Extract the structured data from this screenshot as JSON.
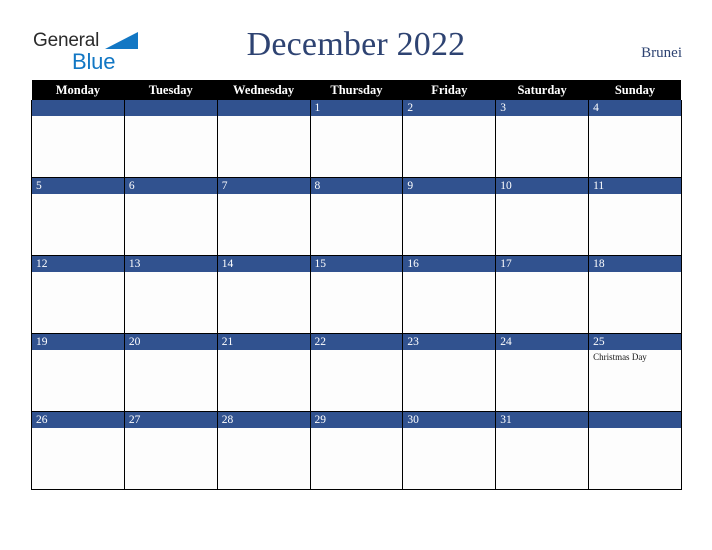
{
  "brand": {
    "name_part1": "General",
    "name_part2": "Blue",
    "triangle_icon": "triangle-icon",
    "color_dark": "#2b2b2b",
    "color_blue": "#1277c4"
  },
  "header": {
    "title": "December 2022",
    "country": "Brunei",
    "title_color": "#2e4372"
  },
  "calendar": {
    "accent_color": "#31528f",
    "header_bg": "#000000",
    "weekdays": [
      "Monday",
      "Tuesday",
      "Wednesday",
      "Thursday",
      "Friday",
      "Saturday",
      "Sunday"
    ],
    "weeks": [
      [
        {
          "date": "",
          "holiday": ""
        },
        {
          "date": "",
          "holiday": ""
        },
        {
          "date": "",
          "holiday": ""
        },
        {
          "date": "1",
          "holiday": ""
        },
        {
          "date": "2",
          "holiday": ""
        },
        {
          "date": "3",
          "holiday": ""
        },
        {
          "date": "4",
          "holiday": ""
        }
      ],
      [
        {
          "date": "5",
          "holiday": ""
        },
        {
          "date": "6",
          "holiday": ""
        },
        {
          "date": "7",
          "holiday": ""
        },
        {
          "date": "8",
          "holiday": ""
        },
        {
          "date": "9",
          "holiday": ""
        },
        {
          "date": "10",
          "holiday": ""
        },
        {
          "date": "11",
          "holiday": ""
        }
      ],
      [
        {
          "date": "12",
          "holiday": ""
        },
        {
          "date": "13",
          "holiday": ""
        },
        {
          "date": "14",
          "holiday": ""
        },
        {
          "date": "15",
          "holiday": ""
        },
        {
          "date": "16",
          "holiday": ""
        },
        {
          "date": "17",
          "holiday": ""
        },
        {
          "date": "18",
          "holiday": ""
        }
      ],
      [
        {
          "date": "19",
          "holiday": ""
        },
        {
          "date": "20",
          "holiday": ""
        },
        {
          "date": "21",
          "holiday": ""
        },
        {
          "date": "22",
          "holiday": ""
        },
        {
          "date": "23",
          "holiday": ""
        },
        {
          "date": "24",
          "holiday": ""
        },
        {
          "date": "25",
          "holiday": "Christmas Day"
        }
      ],
      [
        {
          "date": "26",
          "holiday": ""
        },
        {
          "date": "27",
          "holiday": ""
        },
        {
          "date": "28",
          "holiday": ""
        },
        {
          "date": "29",
          "holiday": ""
        },
        {
          "date": "30",
          "holiday": ""
        },
        {
          "date": "31",
          "holiday": ""
        },
        {
          "date": "",
          "holiday": ""
        }
      ]
    ]
  }
}
